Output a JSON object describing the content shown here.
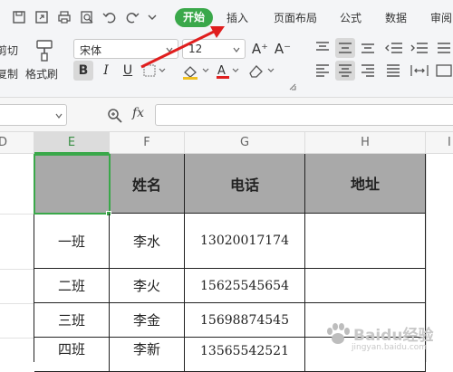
{
  "ribbon": {
    "tabs": [
      "开始",
      "插入",
      "页面布局",
      "公式",
      "数据",
      "审阅"
    ],
    "cut_label": "剪切",
    "copy_label": "复制",
    "format_painter_label": "格式刷",
    "font_name": "宋体",
    "font_size": "12",
    "bold": "B",
    "italic": "I",
    "underline": "U",
    "font_color_letter": "A",
    "increase_font": "A⁺",
    "decrease_font": "A⁻",
    "accent_color": "#3aa84a"
  },
  "formula_bar": {
    "fx_label": "fx",
    "formula": ""
  },
  "columns": [
    "D",
    "E",
    "F",
    "G",
    "H",
    "I"
  ],
  "selected_column": "E",
  "table": {
    "headers": [
      "",
      "姓名",
      "电话",
      "地址"
    ],
    "rows": [
      [
        "一班",
        "李水",
        "13020017174",
        ""
      ],
      [
        "二班",
        "李火",
        "15625545654",
        ""
      ],
      [
        "三班",
        "李金",
        "15698874545",
        ""
      ],
      [
        "四班",
        "李新",
        "13565542521",
        ""
      ]
    ]
  },
  "watermark": {
    "text": "Baidu经验",
    "url": "jingyan.baidu.com"
  }
}
